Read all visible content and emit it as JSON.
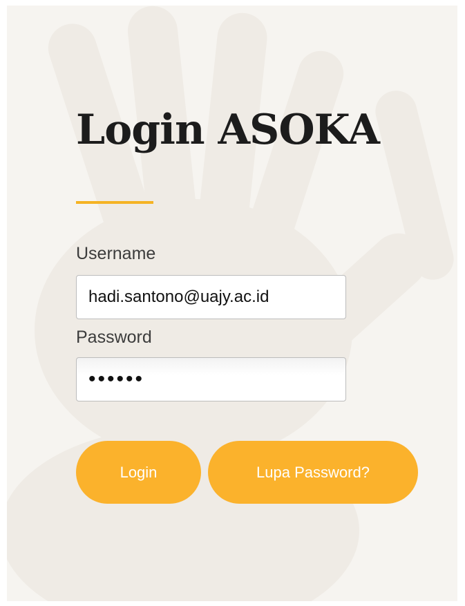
{
  "page": {
    "title": "Login ASOKA",
    "accent_color": "#f5b324",
    "background_color": "#f6f4f0"
  },
  "form": {
    "username_label": "Username",
    "username_value": "hadi.santono@uajy.ac.id",
    "password_label": "Password",
    "password_value": "••••••"
  },
  "buttons": {
    "login_label": "Login",
    "forgot_label": "Lupa Password?",
    "color": "#fbb22c"
  }
}
